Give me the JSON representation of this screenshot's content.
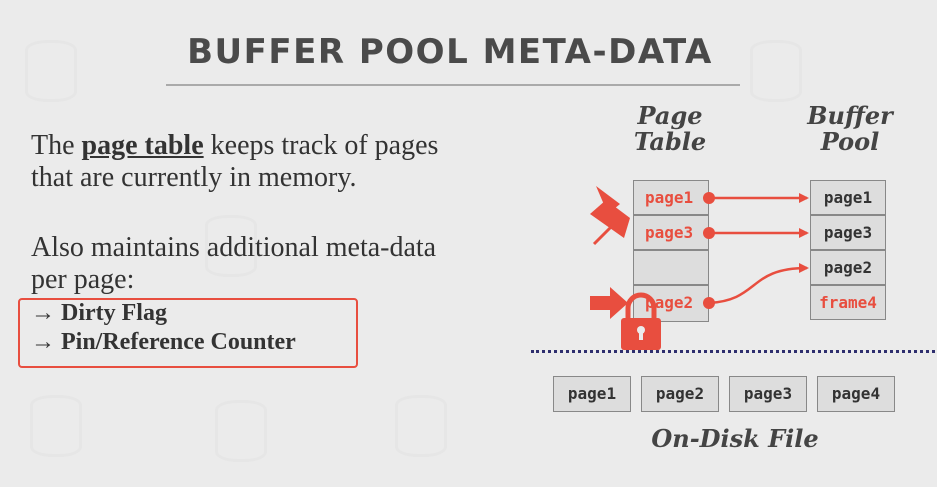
{
  "title": "BUFFER POOL META-DATA",
  "para1": {
    "before": "The ",
    "bold": "page table",
    "after1": " keeps track of pages",
    "line2": "that are currently in memory."
  },
  "para2": {
    "line1": "Also maintains additional meta-data",
    "line2": "per page:"
  },
  "bullets": [
    "→ Dirty Flag",
    "→ Pin/Reference Counter"
  ],
  "page_table": {
    "heading_1": "Page",
    "heading_2": "Table",
    "rows": [
      "page1",
      "page3",
      "",
      "page2"
    ]
  },
  "buffer_pool": {
    "heading_1": "Buffer",
    "heading_2": "Pool",
    "frames": [
      "page1",
      "page3",
      "page2",
      "frame4"
    ]
  },
  "disk": {
    "pages": [
      "page1",
      "page2",
      "page3",
      "page4"
    ],
    "label": "On-Disk File"
  },
  "colors": {
    "accent": "#e84e3f",
    "text": "#333333",
    "box_fill": "#dddddd",
    "divider": "#2e2e6e"
  },
  "icons": [
    "pushpin-icon",
    "arrow-right-icon",
    "padlock-icon"
  ]
}
